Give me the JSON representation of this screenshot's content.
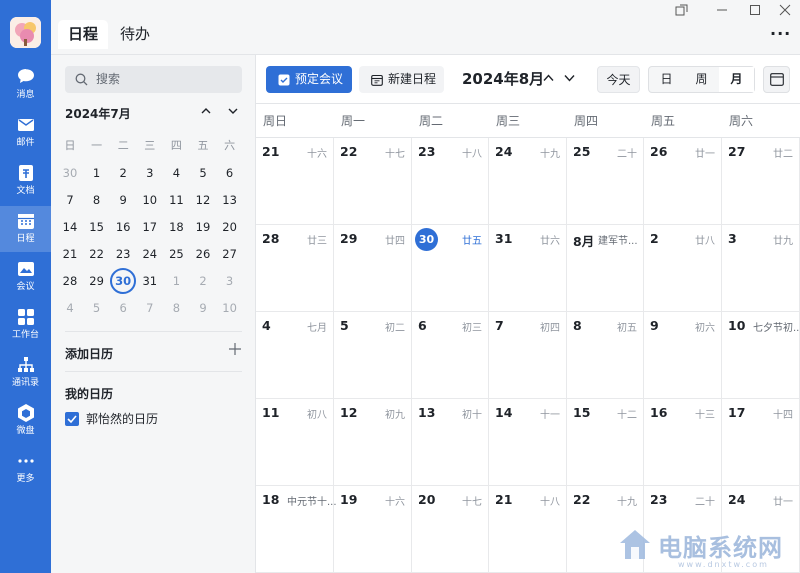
{
  "rail": {
    "items": [
      {
        "label": "消息",
        "icon": "chat-icon"
      },
      {
        "label": "邮件",
        "icon": "mail-icon"
      },
      {
        "label": "文档",
        "icon": "doc-icon"
      },
      {
        "label": "日程",
        "icon": "calendar-icon",
        "active": true
      },
      {
        "label": "会议",
        "icon": "meeting-icon"
      },
      {
        "label": "工作台",
        "icon": "workbench-icon"
      },
      {
        "label": "通讯录",
        "icon": "contacts-icon"
      },
      {
        "label": "微盘",
        "icon": "drive-icon"
      },
      {
        "label": "更多",
        "icon": "more-icon"
      }
    ]
  },
  "header": {
    "tabs": [
      {
        "label": "日程",
        "active": true
      },
      {
        "label": "待办",
        "active": false
      }
    ],
    "more": "···"
  },
  "sidebar": {
    "search_placeholder": "搜索",
    "mini_calendar": {
      "title": "2024年7月",
      "weekdays": [
        "日",
        "一",
        "二",
        "三",
        "四",
        "五",
        "六"
      ],
      "weeks": [
        [
          "30",
          "1",
          "2",
          "3",
          "4",
          "5",
          "6"
        ],
        [
          "7",
          "8",
          "9",
          "10",
          "11",
          "12",
          "13"
        ],
        [
          "14",
          "15",
          "16",
          "17",
          "18",
          "19",
          "20"
        ],
        [
          "21",
          "22",
          "23",
          "24",
          "25",
          "26",
          "27"
        ],
        [
          "28",
          "29",
          "30",
          "31",
          "1",
          "2",
          "3"
        ],
        [
          "4",
          "5",
          "6",
          "7",
          "8",
          "9",
          "10"
        ]
      ]
    },
    "add_calendar": "添加日历",
    "my_calendars": "我的日历",
    "calendar_item": "郭怡然的日历"
  },
  "toolbar": {
    "book_meeting": "预定会议",
    "new_event": "新建日程",
    "month_title": "2024年8月",
    "today": "今天",
    "views": [
      "日",
      "周",
      "月"
    ],
    "active_view": "月"
  },
  "calendar": {
    "weekdays": [
      "周日",
      "周一",
      "周二",
      "周三",
      "周四",
      "周五",
      "周六"
    ],
    "weeks": [
      [
        {
          "d": "21",
          "l": "十六"
        },
        {
          "d": "22",
          "l": "十七"
        },
        {
          "d": "23",
          "l": "十八"
        },
        {
          "d": "24",
          "l": "十九"
        },
        {
          "d": "25",
          "l": "二十"
        },
        {
          "d": "26",
          "l": "廿一"
        },
        {
          "d": "27",
          "l": "廿二"
        }
      ],
      [
        {
          "d": "28",
          "l": "廿三"
        },
        {
          "d": "29",
          "l": "廿四"
        },
        {
          "d": "30",
          "l": "廿五",
          "today": true
        },
        {
          "d": "31",
          "l": "廿六"
        },
        {
          "d": "8月",
          "l": "",
          "f": "建军节..."
        },
        {
          "d": "2",
          "l": "廿八"
        },
        {
          "d": "3",
          "l": "廿九"
        }
      ],
      [
        {
          "d": "4",
          "l": "七月"
        },
        {
          "d": "5",
          "l": "初二"
        },
        {
          "d": "6",
          "l": "初三"
        },
        {
          "d": "7",
          "l": "初四"
        },
        {
          "d": "8",
          "l": "初五"
        },
        {
          "d": "9",
          "l": "初六"
        },
        {
          "d": "10",
          "l": "",
          "f": "七夕节初..."
        }
      ],
      [
        {
          "d": "11",
          "l": "初八"
        },
        {
          "d": "12",
          "l": "初九"
        },
        {
          "d": "13",
          "l": "初十"
        },
        {
          "d": "14",
          "l": "十一"
        },
        {
          "d": "15",
          "l": "十二"
        },
        {
          "d": "16",
          "l": "十三"
        },
        {
          "d": "17",
          "l": "十四"
        }
      ],
      [
        {
          "d": "18",
          "l": "",
          "f": "中元节十..."
        },
        {
          "d": "19",
          "l": "十六"
        },
        {
          "d": "20",
          "l": "十七"
        },
        {
          "d": "21",
          "l": "十八"
        },
        {
          "d": "22",
          "l": "十九"
        },
        {
          "d": "23",
          "l": "二十"
        },
        {
          "d": "24",
          "l": "廿一"
        }
      ]
    ]
  },
  "watermark": {
    "text": "电脑系统网",
    "url": "www.dnxtw.com"
  },
  "colors": {
    "accent": "#2f6fd6",
    "rail": "#2f6fd6",
    "muted": "#8f959e"
  }
}
